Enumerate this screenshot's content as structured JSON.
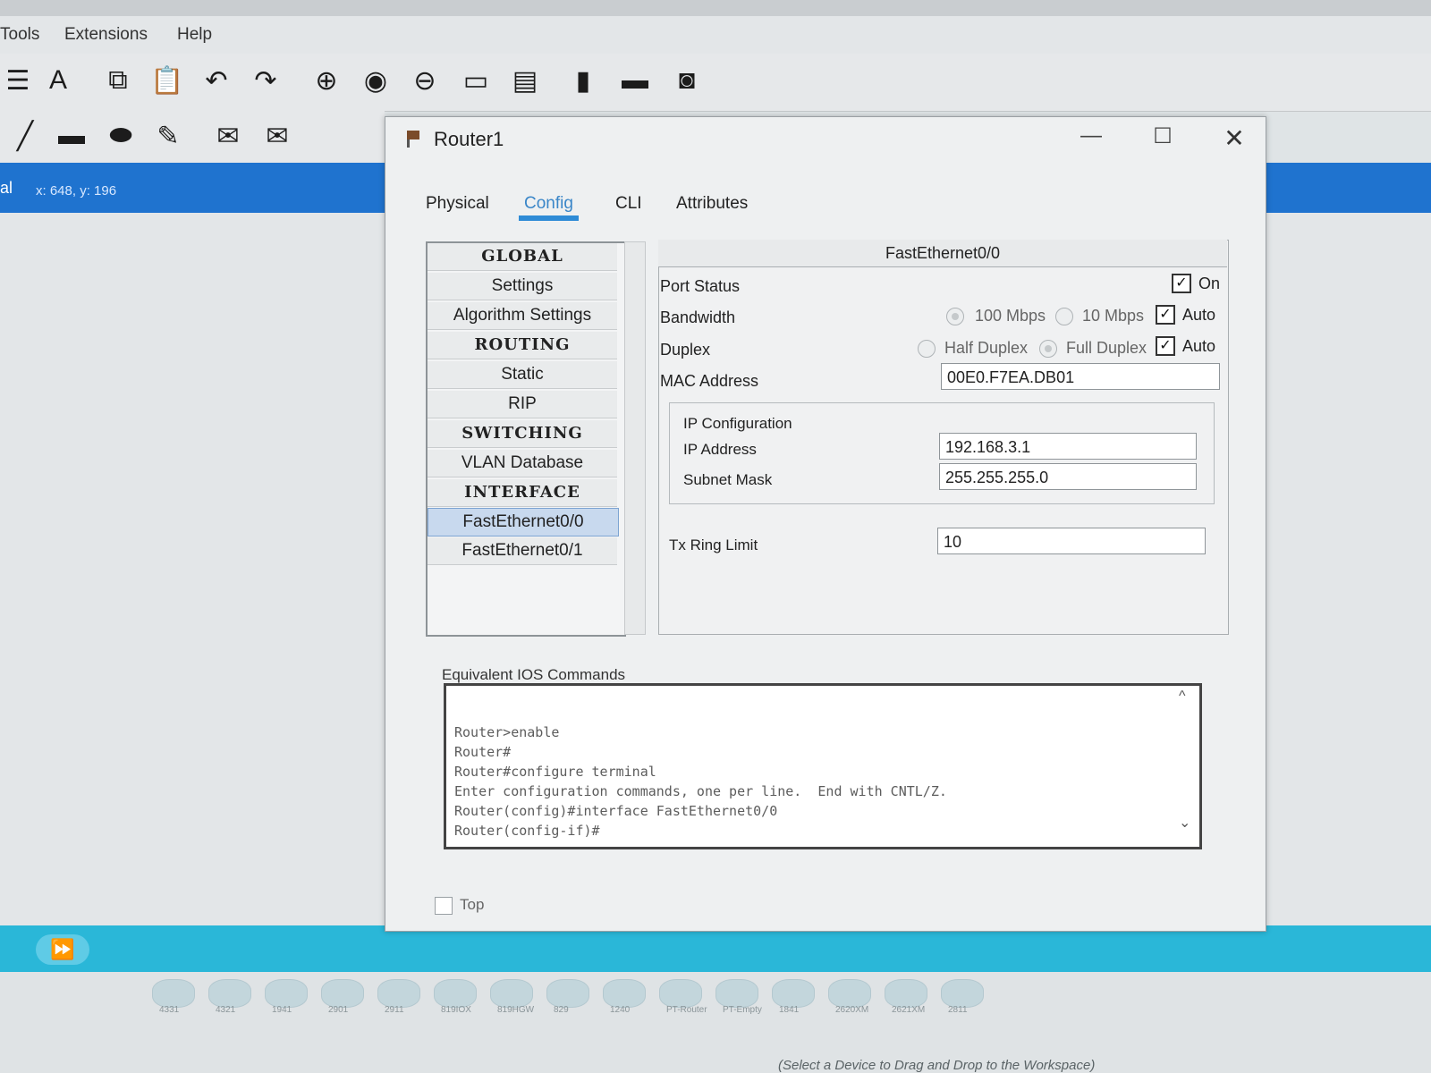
{
  "menu": {
    "items": [
      "Tools",
      "Extensions",
      "Help"
    ]
  },
  "workspace": {
    "coords": "x: 648, y: 196",
    "coord_prefix": "al"
  },
  "dialog": {
    "title": "Router1",
    "tabs": [
      "Physical",
      "Config",
      "CLI",
      "Attributes"
    ],
    "left_list": [
      "GLOBAL",
      "Settings",
      "Algorithm Settings",
      "ROUTING",
      "Static",
      "RIP",
      "SWITCHING",
      "VLAN Database",
      "INTERFACE",
      "FastEthernet0/0",
      "FastEthernet0/1"
    ],
    "interface": {
      "name": "FastEthernet0/0",
      "port_status_label": "Port Status",
      "port_status_on": "On",
      "bandwidth_label": "Bandwidth",
      "bw_100": "100 Mbps",
      "bw_10": "10 Mbps",
      "bw_auto": "Auto",
      "duplex_label": "Duplex",
      "dup_half": "Half Duplex",
      "dup_full": "Full Duplex",
      "dup_auto": "Auto",
      "mac_label": "MAC Address",
      "mac_value": "00E0.F7EA.DB01",
      "ip_config_label": "IP Configuration",
      "ip_label": "IP Address",
      "ip_value": "192.168.3.1",
      "mask_label": "Subnet Mask",
      "mask_value": "255.255.255.0",
      "tx_label": "Tx Ring Limit",
      "tx_value": "10"
    },
    "ios": {
      "label": "Equivalent IOS Commands",
      "lines": "Router>enable\nRouter#\nRouter#configure terminal\nEnter configuration commands, one per line.  End with CNTL/Z.\nRouter(config)#interface FastEthernet0/0\nRouter(config-if)#"
    },
    "top_label": "Top"
  },
  "devices": [
    "4331",
    "4321",
    "1941",
    "2901",
    "2911",
    "819IOX",
    "819HGW",
    "829",
    "1240",
    "PT-Router",
    "PT-Empty",
    "1841",
    "2620XM",
    "2621XM",
    "2811"
  ],
  "status": "(Select a Device to Drag and Drop to the Workspace)"
}
